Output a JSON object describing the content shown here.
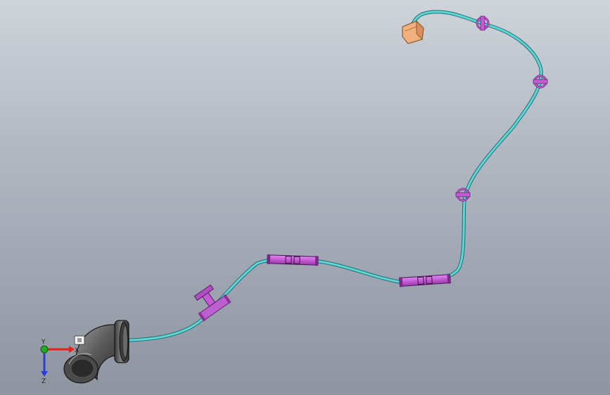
{
  "scene": {
    "colors": {
      "cable": "#5fd6d3",
      "cable_outline": "#1f6f74",
      "clip": "#c45ad4",
      "clip_outline": "#5a1c66",
      "connector": "#f2b07e",
      "elbow": "#6d6d6d"
    }
  },
  "triad": {
    "x_label": "X",
    "y_label": "Y",
    "z_label": "Z",
    "colors": {
      "x": "#e52020",
      "y": "#22aa22",
      "z": "#2840d8"
    }
  }
}
